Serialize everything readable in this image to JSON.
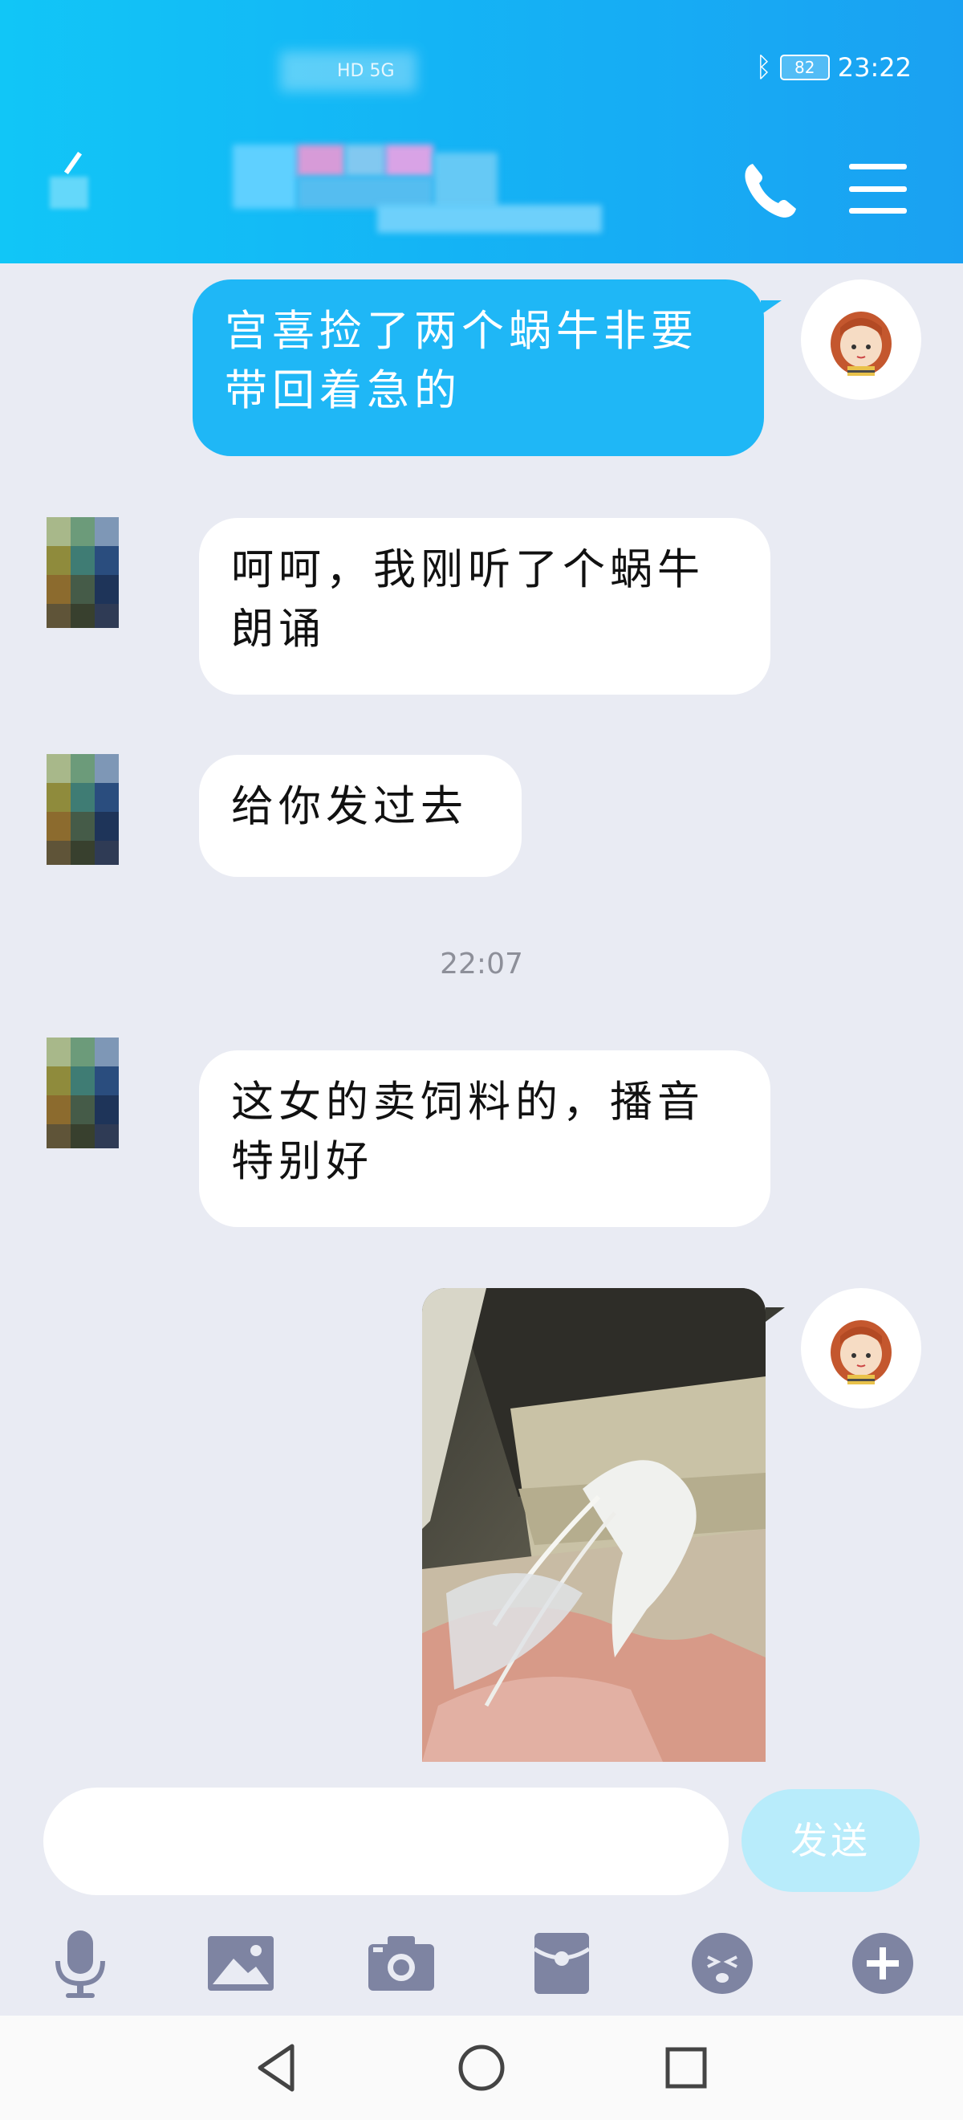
{
  "status_bar": {
    "network": "HD 5G",
    "battery": "82",
    "time": "23:22"
  },
  "header": {
    "icons": [
      "back-icon",
      "phone-icon",
      "menu-icon"
    ]
  },
  "messages": [
    {
      "side": "out",
      "text": "宫喜捡了两个蜗牛非要带回着急的"
    },
    {
      "side": "in",
      "text": "呵呵，我刚听了个蜗牛朗诵"
    },
    {
      "side": "in",
      "text": "给你发过去"
    },
    {
      "side": "timestamp",
      "text": "22:07"
    },
    {
      "side": "in",
      "text": "这女的卖饲料的，播音特别好"
    },
    {
      "side": "out",
      "type": "image"
    }
  ],
  "composer": {
    "placeholder": "",
    "send_label": "发送"
  },
  "toolbar": {
    "items": [
      "microphone-icon",
      "image-icon",
      "camera-icon",
      "red-packet-icon",
      "emoji-icon",
      "plus-icon"
    ]
  },
  "navbar": {
    "items": [
      "back-triangle-icon",
      "home-circle-icon",
      "recents-square-icon"
    ]
  },
  "colors": {
    "header": "#14b4f5",
    "outgoing_bubble": "#1fb7f6",
    "incoming_bubble": "#ffffff",
    "background": "#e9ebf3",
    "send_button": "#b8ecfb"
  }
}
